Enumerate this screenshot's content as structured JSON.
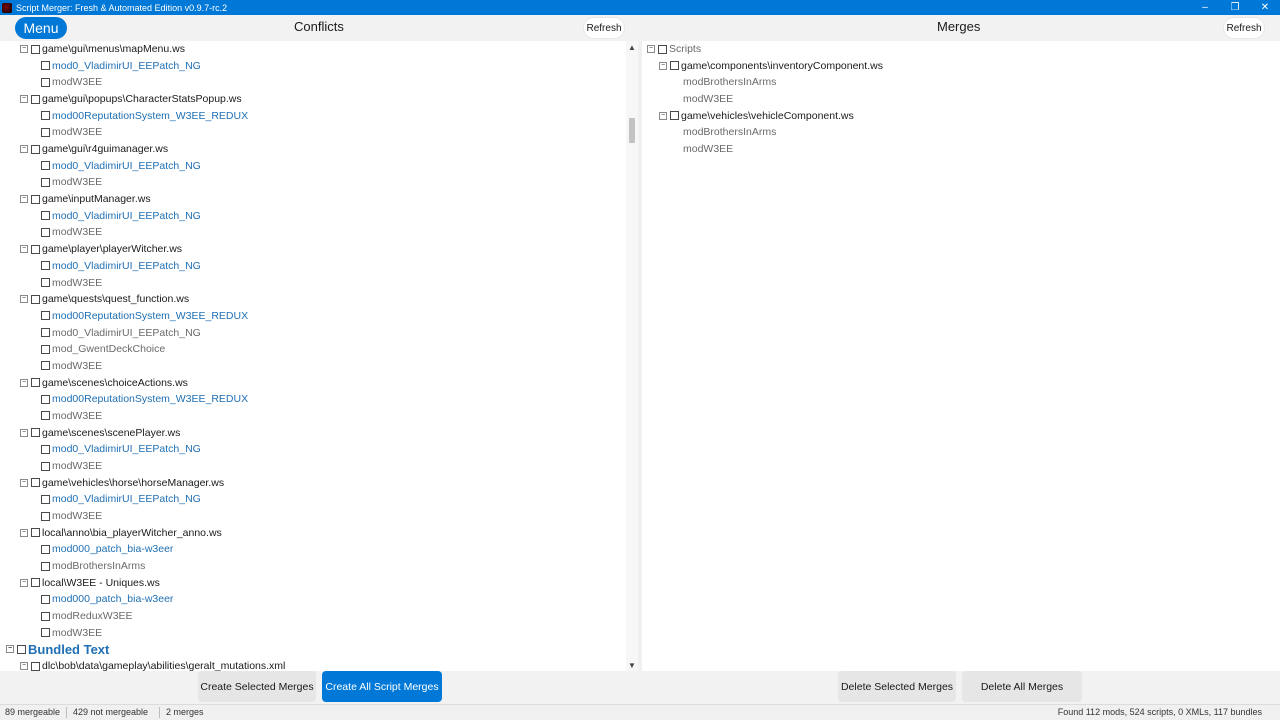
{
  "window": {
    "title": "Script Merger: Fresh & Automated Edition v0.9.7-rc.2",
    "controls": {
      "minimize": "–",
      "maximize": "❐",
      "close": "✕"
    }
  },
  "header": {
    "menu_label": "Menu",
    "conflicts_title": "Conflicts",
    "merges_title": "Merges",
    "refresh_left": "Refresh",
    "refresh_right": "Refresh"
  },
  "conflicts": {
    "entries": [
      {
        "kind": "file",
        "label": "game\\gui\\menus\\mapMenu.ws"
      },
      {
        "kind": "mod",
        "label": "mod0_VladimirUI_EEPatch_NG",
        "style": "blue"
      },
      {
        "kind": "mod",
        "label": "modW3EE",
        "style": "gray"
      },
      {
        "kind": "file",
        "label": "game\\gui\\popups\\CharacterStatsPopup.ws"
      },
      {
        "kind": "mod",
        "label": "mod00ReputationSystem_W3EE_REDUX",
        "style": "blue"
      },
      {
        "kind": "mod",
        "label": "modW3EE",
        "style": "gray"
      },
      {
        "kind": "file",
        "label": "game\\gui\\r4guimanager.ws"
      },
      {
        "kind": "mod",
        "label": "mod0_VladimirUI_EEPatch_NG",
        "style": "blue"
      },
      {
        "kind": "mod",
        "label": "modW3EE",
        "style": "gray"
      },
      {
        "kind": "file",
        "label": "game\\inputManager.ws"
      },
      {
        "kind": "mod",
        "label": "mod0_VladimirUI_EEPatch_NG",
        "style": "blue"
      },
      {
        "kind": "mod",
        "label": "modW3EE",
        "style": "gray"
      },
      {
        "kind": "file",
        "label": "game\\player\\playerWitcher.ws"
      },
      {
        "kind": "mod",
        "label": "mod0_VladimirUI_EEPatch_NG",
        "style": "blue"
      },
      {
        "kind": "mod",
        "label": "modW3EE",
        "style": "gray"
      },
      {
        "kind": "file",
        "label": "game\\quests\\quest_function.ws"
      },
      {
        "kind": "mod",
        "label": "mod00ReputationSystem_W3EE_REDUX",
        "style": "blue"
      },
      {
        "kind": "mod",
        "label": "mod0_VladimirUI_EEPatch_NG",
        "style": "gray"
      },
      {
        "kind": "mod",
        "label": "mod_GwentDeckChoice",
        "style": "gray"
      },
      {
        "kind": "mod",
        "label": "modW3EE",
        "style": "gray"
      },
      {
        "kind": "file",
        "label": "game\\scenes\\choiceActions.ws"
      },
      {
        "kind": "mod",
        "label": "mod00ReputationSystem_W3EE_REDUX",
        "style": "blue"
      },
      {
        "kind": "mod",
        "label": "modW3EE",
        "style": "gray"
      },
      {
        "kind": "file",
        "label": "game\\scenes\\scenePlayer.ws"
      },
      {
        "kind": "mod",
        "label": "mod0_VladimirUI_EEPatch_NG",
        "style": "blue"
      },
      {
        "kind": "mod",
        "label": "modW3EE",
        "style": "gray"
      },
      {
        "kind": "file",
        "label": "game\\vehicles\\horse\\horseManager.ws"
      },
      {
        "kind": "mod",
        "label": "mod0_VladimirUI_EEPatch_NG",
        "style": "blue"
      },
      {
        "kind": "mod",
        "label": "modW3EE",
        "style": "gray"
      },
      {
        "kind": "file",
        "label": "local\\anno\\bia_playerWitcher_anno.ws"
      },
      {
        "kind": "mod",
        "label": "mod000_patch_bia-w3eer",
        "style": "blue"
      },
      {
        "kind": "mod",
        "label": "modBrothersInArms",
        "style": "gray"
      },
      {
        "kind": "file",
        "label": "local\\W3EE - Uniques.ws"
      },
      {
        "kind": "mod",
        "label": "mod000_patch_bia-w3eer",
        "style": "blue"
      },
      {
        "kind": "mod",
        "label": "modReduxW3EE",
        "style": "gray"
      },
      {
        "kind": "mod",
        "label": "modW3EE",
        "style": "gray"
      },
      {
        "kind": "category",
        "label": "Bundled Text"
      },
      {
        "kind": "file",
        "label": "dlc\\bob\\data\\gameplay\\abilities\\geralt_mutations.xml"
      }
    ]
  },
  "merges": {
    "entries": [
      {
        "kind": "root",
        "label": "Scripts"
      },
      {
        "kind": "file",
        "label": "game\\components\\inventoryComponent.ws"
      },
      {
        "kind": "mod",
        "label": "modBrothersInArms"
      },
      {
        "kind": "mod",
        "label": "modW3EE"
      },
      {
        "kind": "file",
        "label": "game\\vehicles\\vehicleComponent.ws"
      },
      {
        "kind": "mod",
        "label": "modBrothersInArms"
      },
      {
        "kind": "mod",
        "label": "modW3EE"
      }
    ]
  },
  "buttons": {
    "create_selected": "Create Selected Merges",
    "create_all": "Create All Script Merges",
    "delete_selected": "Delete Selected Merges",
    "delete_all": "Delete All Merges"
  },
  "status": {
    "mergeable": "89 mergeable",
    "not_mergeable": "429 not mergeable",
    "merges": "2 merges",
    "found": "Found 112 mods, 524 scripts, 0 XMLs, 117 bundles"
  },
  "colors": {
    "accent": "#0078d7",
    "mod_link": "#1f6fb4",
    "mod_gray": "#6a6a6a"
  }
}
